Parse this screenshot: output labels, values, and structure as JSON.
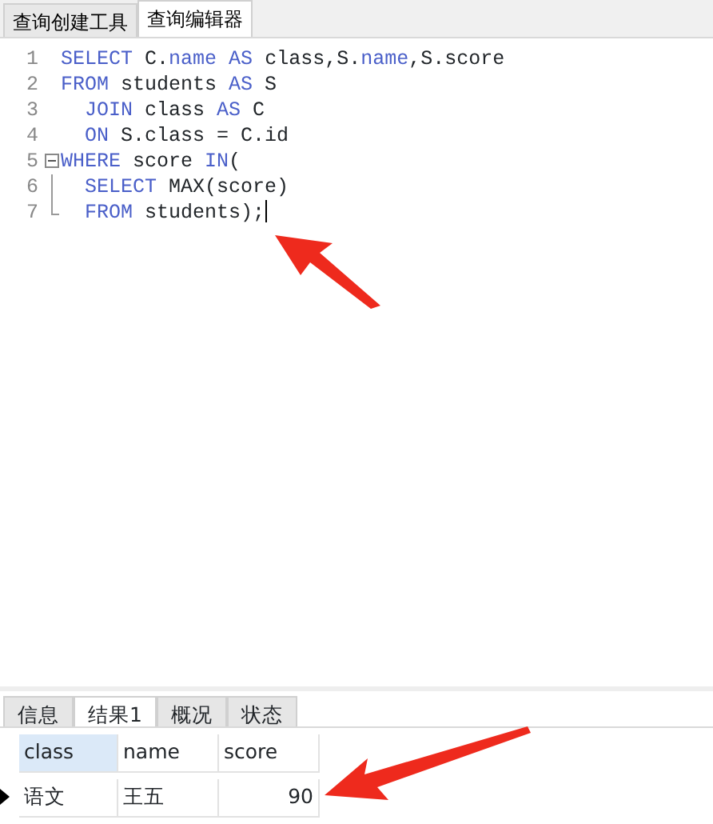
{
  "top_tabs": [
    {
      "label": "查询创建工具",
      "selected": false
    },
    {
      "label": "查询编辑器",
      "selected": true
    }
  ],
  "editor": {
    "lines": [
      {
        "number": "1",
        "kind": "plain",
        "tokens": [
          {
            "text": "SELECT",
            "kind": "keyword"
          },
          {
            "text": " C.",
            "kind": "plain"
          },
          {
            "text": "name",
            "kind": "keyword"
          },
          {
            "text": " AS",
            "kind": "keyword"
          },
          {
            "text": " class,S.",
            "kind": "plain"
          },
          {
            "text": "name",
            "kind": "keyword"
          },
          {
            "text": ",S.score",
            "kind": "plain"
          }
        ]
      },
      {
        "number": "2",
        "kind": "plain",
        "tokens": [
          {
            "text": "FROM",
            "kind": "keyword"
          },
          {
            "text": " students ",
            "kind": "plain"
          },
          {
            "text": "AS",
            "kind": "keyword"
          },
          {
            "text": " S",
            "kind": "plain"
          }
        ]
      },
      {
        "number": "3",
        "kind": "plain",
        "tokens": [
          {
            "text": "  JOIN",
            "kind": "keyword"
          },
          {
            "text": " class ",
            "kind": "plain"
          },
          {
            "text": "AS",
            "kind": "keyword"
          },
          {
            "text": " C",
            "kind": "plain"
          }
        ]
      },
      {
        "number": "4",
        "kind": "plain",
        "tokens": [
          {
            "text": "  ON",
            "kind": "keyword"
          },
          {
            "text": " S.class = C.id",
            "kind": "plain"
          }
        ]
      },
      {
        "number": "5",
        "kind": "fold_start",
        "tokens": [
          {
            "text": "WHERE",
            "kind": "keyword"
          },
          {
            "text": " score ",
            "kind": "plain"
          },
          {
            "text": "IN",
            "kind": "keyword"
          },
          {
            "text": "(",
            "kind": "plain"
          }
        ]
      },
      {
        "number": "6",
        "kind": "fold_middle",
        "tokens": [
          {
            "text": "  SELECT",
            "kind": "keyword"
          },
          {
            "text": " MAX(score)",
            "kind": "plain"
          }
        ]
      },
      {
        "number": "7",
        "kind": "fold_end",
        "tokens": [
          {
            "text": "  FROM",
            "kind": "keyword"
          },
          {
            "text": " students);",
            "kind": "plain"
          }
        ]
      }
    ]
  },
  "bottom_tabs": [
    {
      "label": "信息",
      "selected": false
    },
    {
      "label": "结果1",
      "selected": true
    },
    {
      "label": "概况",
      "selected": false
    },
    {
      "label": "状态",
      "selected": false
    }
  ],
  "result": {
    "columns": [
      "class",
      "name",
      "score"
    ],
    "rows": [
      {
        "current": true,
        "cells": [
          "语文",
          "王五",
          "90"
        ]
      }
    ]
  }
}
